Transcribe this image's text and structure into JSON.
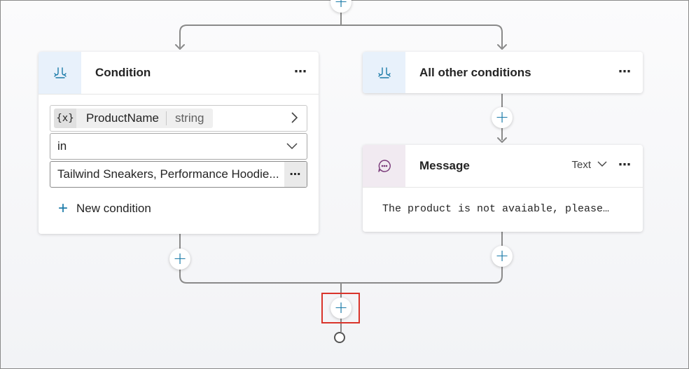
{
  "condition_card": {
    "title": "Condition",
    "more_label": "⋯",
    "variable_icon": "{x}",
    "variable_name": "ProductName",
    "variable_type": "string",
    "operator": "in",
    "value": "Tailwind Sneakers, Performance Hoodie...",
    "value_more_label": "⋯",
    "new_condition_label": "New condition"
  },
  "other_card": {
    "title": "All other conditions",
    "more_label": "⋯"
  },
  "message_card": {
    "title": "Message",
    "type_label": "Text",
    "more_label": "⋯",
    "text": "The product is not avaiable, please…"
  },
  "icons": {
    "branch": "branch-icon",
    "message": "chat-bubble-icon",
    "add": "plus-icon",
    "end": "end-node-icon"
  },
  "colors": {
    "accent": "#1a7aa8",
    "highlight": "#d9342b",
    "condition_icon_bg": "#e8f1fb",
    "message_icon_bg": "#f1eaf1"
  }
}
